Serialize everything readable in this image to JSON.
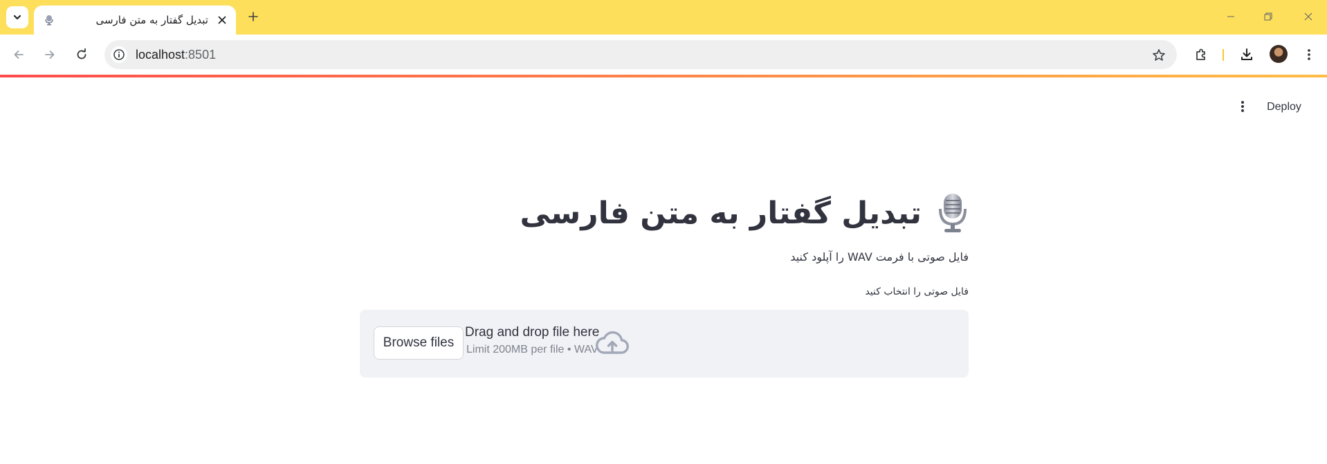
{
  "browser": {
    "tab_title": "تبدیل گفتار به متن فارسی",
    "url_host": "localhost",
    "url_port": ":8501"
  },
  "header": {
    "deploy_label": "Deploy"
  },
  "main": {
    "title": "تبدیل گفتار به متن فارسی",
    "subtitle": "فایل صوتی با فرمت WAV را آپلود کنید",
    "uploader": {
      "label": "فایل صوتی را انتخاب کنید",
      "browse_label": "Browse files",
      "drag_text": "Drag and drop file here",
      "limit_text": "Limit 200MB per file • WAV"
    }
  },
  "icons": {
    "title_icon": "microphone-icon",
    "upload_icon": "cloud-upload-icon"
  },
  "colors": {
    "tabbar": "#fedf5b",
    "text": "#31333f",
    "dropzone": "#f0f2f6",
    "accent_start": "#ff4b4b",
    "accent_end": "#ffbd45"
  }
}
